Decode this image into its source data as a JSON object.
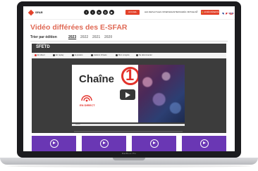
{
  "device": {
    "label": "MacBook Pro"
  },
  "header": {
    "logo_text": "SFAR",
    "social_icons": [
      "facebook-icon",
      "twitter-icon",
      "linkedin-icon",
      "instagram-icon",
      "youtube-icon"
    ],
    "nav": {
      "accueil": "ACCUEIL",
      "replays": "LES REPLAYS",
      "intervenants": "LES INTERVENANTS",
      "congres": "CONGRÈS VIRTUELS",
      "reserve": "ACCÈS RÉSERVÉ"
    },
    "languages": [
      "fr",
      "en"
    ]
  },
  "page": {
    "title": "Vidéo différées des E-SFAR",
    "sort_label": "Trier par édition",
    "years": [
      "2023",
      "2022",
      "2021",
      "2020"
    ],
    "active_year": "2023"
  },
  "player": {
    "brand": "SFETD",
    "brand_sub": "Cliquez ici pour",
    "controls": [
      {
        "label": "En direct",
        "color": "#e3322b"
      },
      {
        "label": "En replay",
        "color": "#333333"
      },
      {
        "label": "E-posters",
        "color": "#333333"
      },
      {
        "label": "Ateliers Virtuels",
        "color": "#333333"
      },
      {
        "label": "Mon congrès",
        "color": "#333333"
      },
      {
        "label": "Se déconnecter",
        "color": "#333333"
      }
    ],
    "channel_word": "Chaîne",
    "channel_number": "1",
    "live_text": "EN DIRECT",
    "progress_label": "Début"
  },
  "cards": [
    {
      "icon": "play-icon"
    },
    {
      "icon": "play-icon"
    },
    {
      "icon": "play-icon"
    },
    {
      "icon": "play-icon"
    }
  ],
  "colors": {
    "brand_red": "#e3422b",
    "title_red": "#e06a56",
    "card_purple": "#6a37b4"
  }
}
